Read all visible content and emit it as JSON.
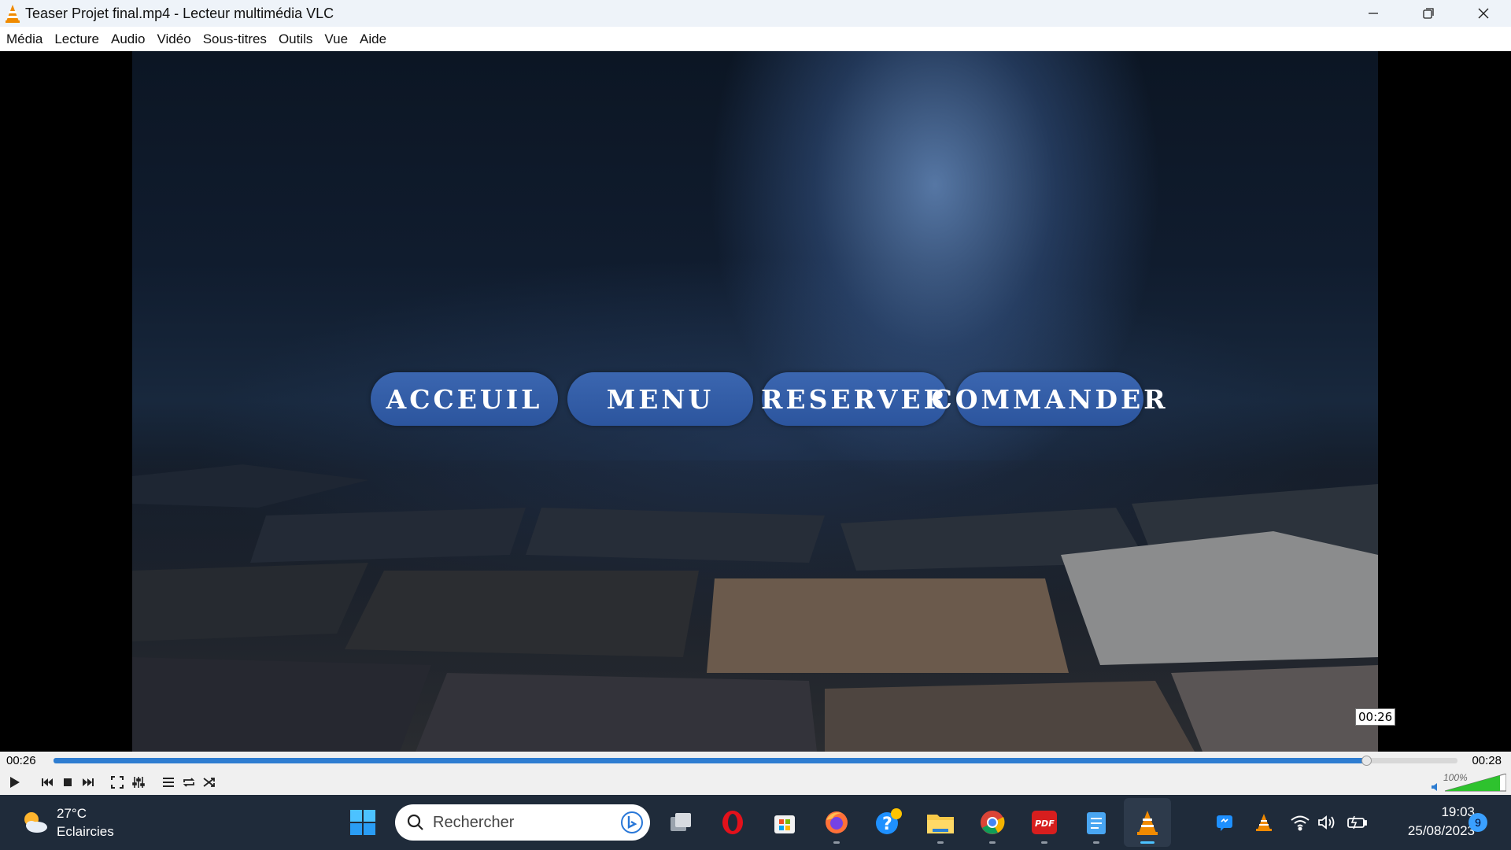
{
  "window": {
    "title": "Teaser Projet final.mp4 - Lecteur multimédia VLC"
  },
  "menu": {
    "items": [
      "Média",
      "Lecture",
      "Audio",
      "Vidéo",
      "Sous-titres",
      "Outils",
      "Vue",
      "Aide"
    ]
  },
  "video": {
    "buttons": [
      "ACCEUIL",
      "MENU",
      "RESERVER",
      "COMMANDER"
    ],
    "tooltip_time": "00:26"
  },
  "player": {
    "elapsed": "00:26",
    "total": "00:28",
    "progress_fraction": 0.935,
    "volume_label": "100%",
    "volume_fraction": 1.0
  },
  "taskbar": {
    "weather_temp": "27°C",
    "weather_desc": "Eclaircies",
    "search_placeholder": "Rechercher",
    "time": "19:03",
    "date": "25/08/2023",
    "notification_count": "9",
    "colors": {
      "accent": "#2e7dd1",
      "vlc_orange": "#f08a00",
      "video_button": "#2c559e"
    }
  }
}
